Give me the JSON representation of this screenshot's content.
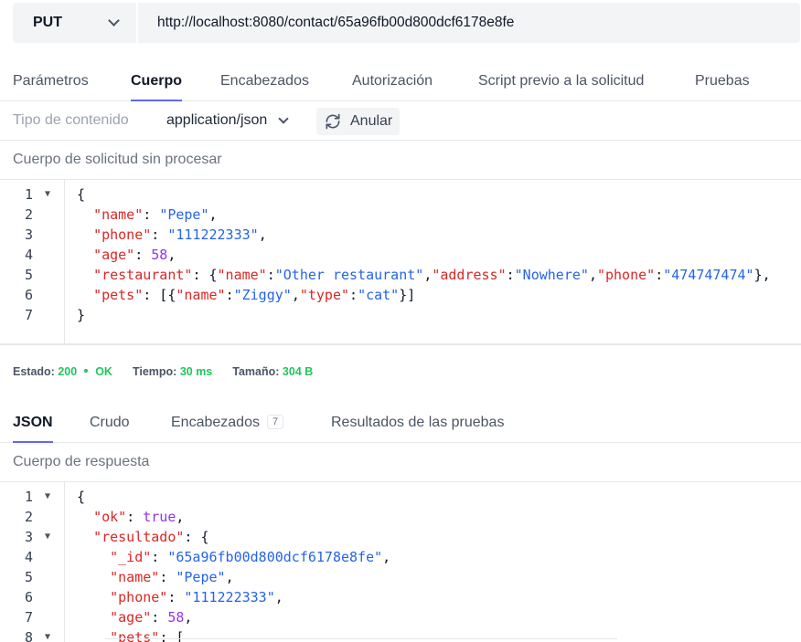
{
  "request": {
    "method": "PUT",
    "url": "http://localhost:8080/contact/65a96fb00d800dcf6178e8fe"
  },
  "request_tabs": [
    {
      "label": "Parámetros"
    },
    {
      "label": "Cuerpo"
    },
    {
      "label": "Encabezados"
    },
    {
      "label": "Autorización"
    },
    {
      "label": "Script previo a la solicitud"
    },
    {
      "label": "Pruebas"
    }
  ],
  "content_type": {
    "label": "Tipo de contenido",
    "value": "application/json",
    "clear_label": "Anular"
  },
  "raw_body_title": "Cuerpo de solicitud sin procesar",
  "status": {
    "status_label": "Estado:",
    "status_code": "200",
    "status_text": "OK",
    "time_label": "Tiempo:",
    "time_value": "30 ms",
    "size_label": "Tamaño:",
    "size_value": "304 B"
  },
  "response_tabs": [
    {
      "label": "JSON"
    },
    {
      "label": "Crudo"
    },
    {
      "label": "Encabezados",
      "badge": "7"
    },
    {
      "label": "Resultados de las pruebas"
    }
  ],
  "response_body_title": "Cuerpo de respuesta",
  "icons": {
    "method_dropdown": "chevron-down-icon",
    "content_type_dropdown": "chevron-down-icon",
    "clear": "refresh-icon",
    "fold": "fold-arrow-icon"
  },
  "colors": {
    "accent": "#6366f1",
    "success": "#22c55e",
    "json_key": "#dc2626",
    "json_string": "#2563eb",
    "json_number": "#9333ea"
  }
}
